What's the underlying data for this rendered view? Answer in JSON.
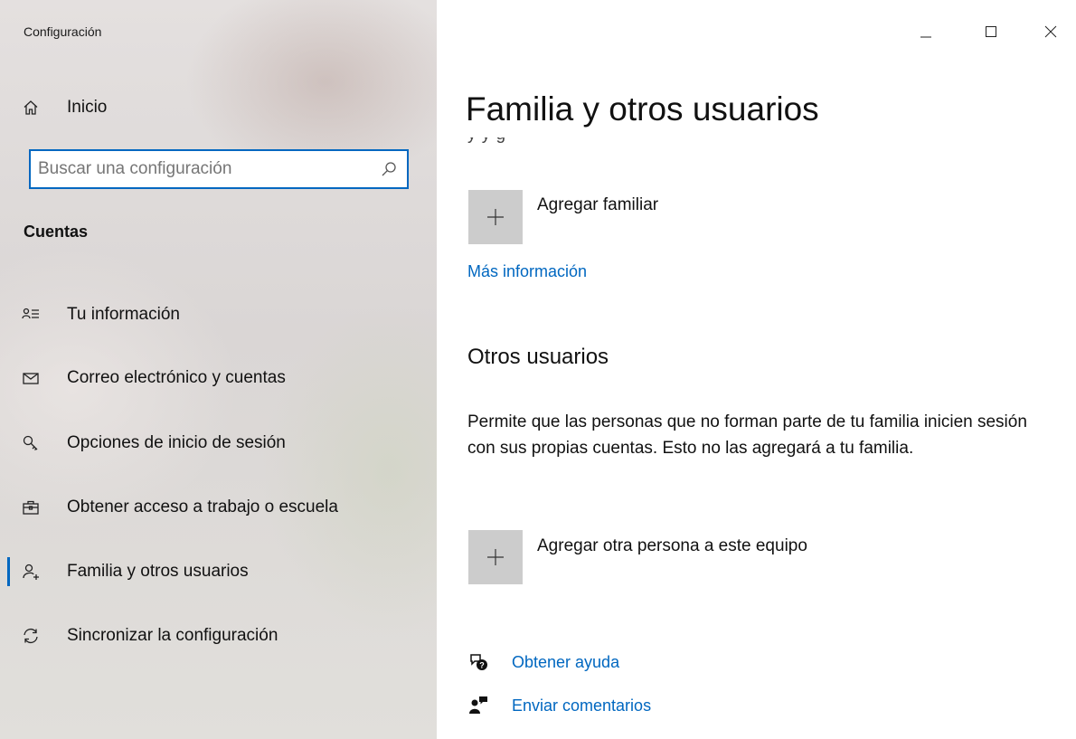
{
  "app": {
    "title": "Configuración"
  },
  "window_controls": {
    "minimize": "minimize-icon",
    "maximize": "maximize-icon",
    "close": "close-icon"
  },
  "sidebar": {
    "home_label": "Inicio",
    "search_placeholder": "Buscar una configuración",
    "search_value": "",
    "section_label": "Cuentas",
    "items": [
      {
        "label": "Tu información",
        "icon": "contact-info-icon",
        "selected": false
      },
      {
        "label": "Correo electrónico y cuentas",
        "icon": "mail-icon",
        "selected": false
      },
      {
        "label": "Opciones de inicio de sesión",
        "icon": "key-icon",
        "selected": false
      },
      {
        "label": "Obtener acceso a trabajo o escuela",
        "icon": "briefcase-icon",
        "selected": false
      },
      {
        "label": "Familia y otros usuarios",
        "icon": "add-person-icon",
        "selected": true
      },
      {
        "label": "Sincronizar la configuración",
        "icon": "sync-icon",
        "selected": false
      }
    ]
  },
  "main": {
    "title": "Familia y otros usuarios",
    "cut_text": "y y g",
    "add_family_label": "Agregar familiar",
    "more_info_link": "Más información",
    "other_users_heading": "Otros usuarios",
    "other_users_description": "Permite que las personas que no forman parte de tu familia inicien sesión con sus propias cuentas. Esto no las agregará a tu familia.",
    "add_other_label": "Agregar otra persona a este equipo",
    "help_link": "Obtener ayuda",
    "feedback_link": "Enviar comentarios"
  },
  "colors": {
    "accent": "#0067c0",
    "tile": "#cccccc"
  }
}
